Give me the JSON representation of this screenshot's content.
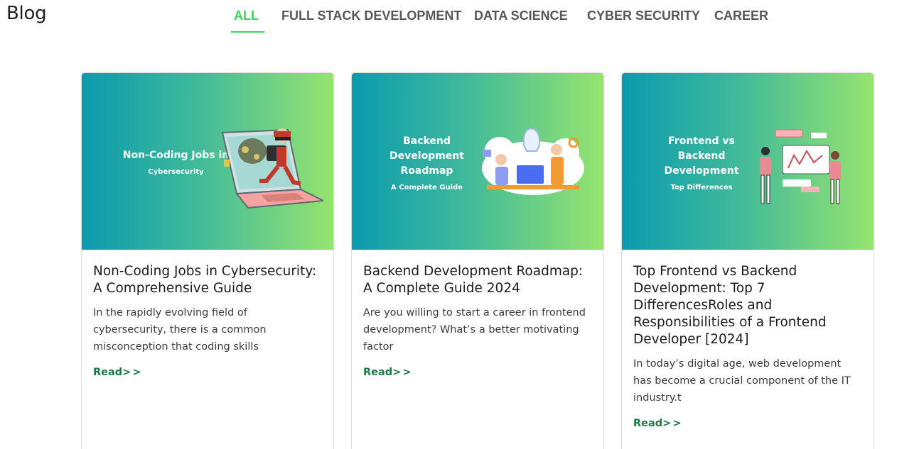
{
  "header": {
    "title": "Blog"
  },
  "nav": {
    "tabs": [
      {
        "label": "ALL",
        "active": true
      },
      {
        "label": "FULL STACK DEVELOPMENT",
        "active": false
      },
      {
        "label": "DATA SCIENCE",
        "active": false
      },
      {
        "label": "CYBER SECURITY",
        "active": false
      },
      {
        "label": "CAREER",
        "active": false
      }
    ]
  },
  "colors": {
    "accent": "#3bd65a",
    "read_more": "#1d7a46",
    "banner_start": "#0b9aae",
    "banner_end": "#97e46f"
  },
  "cards": [
    {
      "image": {
        "heading": "Non-Coding Jobs in",
        "sub": "Cybersecurity",
        "illustration": "thief-escaping-laptop-icon"
      },
      "title": "Non-Coding Jobs in Cybersecurity: A Comprehensive Guide",
      "description": "In the rapidly evolving field of cybersecurity, there is a common misconception that coding skills",
      "read_label": "Read",
      "read_arrows": ">>"
    },
    {
      "image": {
        "heading": "Backend Development Roadmap",
        "sub": "A Complete Guide",
        "illustration": "developers-at-desk-icon"
      },
      "title": "Backend Development Roadmap: A Complete Guide 2024",
      "description": "Are you willing to start a career in frontend development? What’s a better motivating factor",
      "read_label": "Read",
      "read_arrows": ">>"
    },
    {
      "image": {
        "heading": "Frontend vs Backend Development",
        "sub": "Top Differences",
        "illustration": "team-dashboard-icon"
      },
      "title": "Top Frontend vs Backend Development: Top 7 DifferencesRoles and Responsibilities of a Frontend Developer [2024]",
      "description": "In today’s digital age, web development has become a crucial component of the IT industry.t",
      "read_label": "Read",
      "read_arrows": ">>"
    }
  ]
}
